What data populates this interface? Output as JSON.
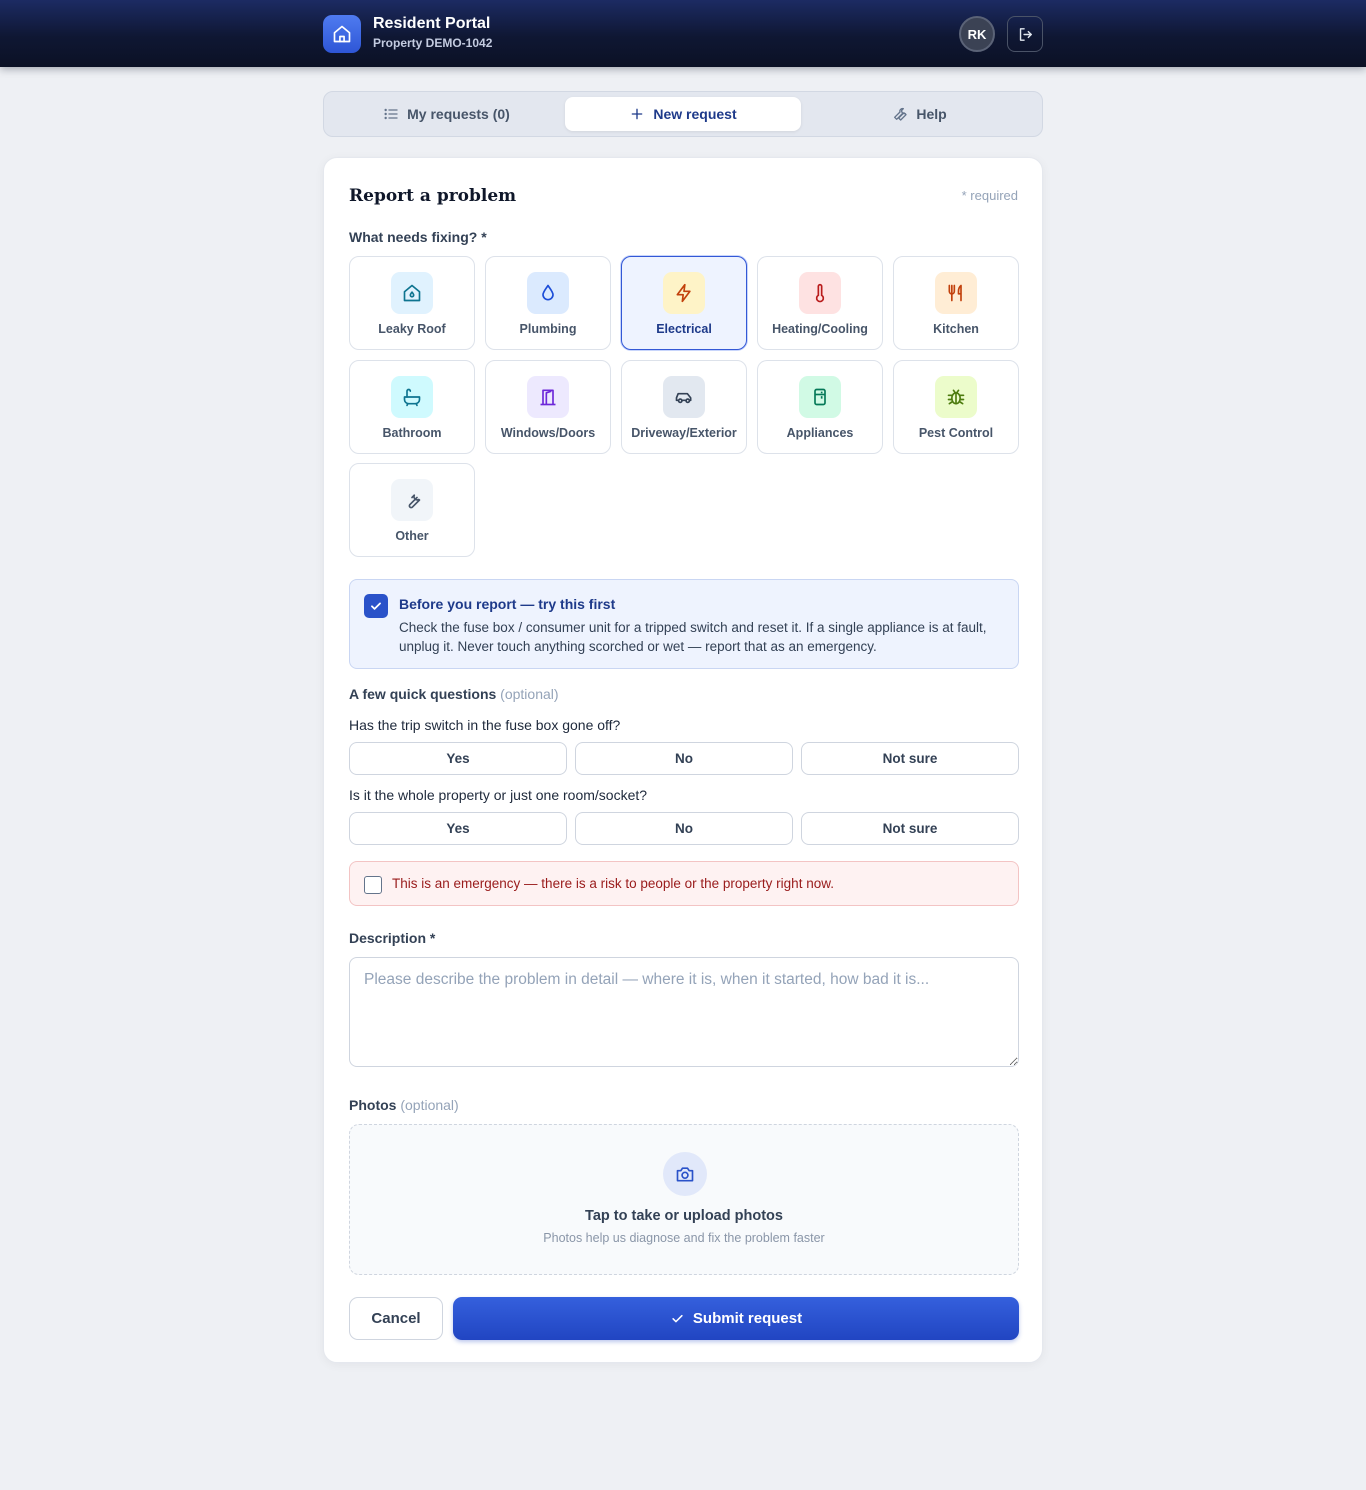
{
  "header": {
    "title": "Resident Portal",
    "subtitle": "Property DEMO-1042",
    "avatar_initials": "RK"
  },
  "tabs": [
    {
      "label": "My requests (0)",
      "icon": "list-icon",
      "active": false
    },
    {
      "label": "New request",
      "icon": "plus-icon",
      "active": true
    },
    {
      "label": "Help",
      "icon": "wrench-icon",
      "active": false
    }
  ],
  "form": {
    "title": "Report a problem",
    "required_note": "* required",
    "category_label": "What needs fixing? *",
    "categories": [
      {
        "label": "Leaky Roof",
        "icon": "house-icon",
        "color": "#0e7490",
        "bg": "#e0f2fe",
        "selected": false
      },
      {
        "label": "Plumbing",
        "icon": "droplet-icon",
        "color": "#1d4ed8",
        "bg": "#dbeafe",
        "selected": false
      },
      {
        "label": "Electrical",
        "icon": "lightning-icon",
        "color": "#c2410c",
        "bg": "#fef3c7",
        "selected": true
      },
      {
        "label": "Heating/Cooling",
        "icon": "thermometer-icon",
        "color": "#b91c1c",
        "bg": "#fee2e2",
        "selected": false
      },
      {
        "label": "Kitchen",
        "icon": "utensils-icon",
        "color": "#c2410c",
        "bg": "#ffedd5",
        "selected": false
      },
      {
        "label": "Bathroom",
        "icon": "bath-icon",
        "color": "#0e7490",
        "bg": "#cffafe",
        "selected": false
      },
      {
        "label": "Windows/Doors",
        "icon": "door-icon",
        "color": "#6d28d9",
        "bg": "#ede9fe",
        "selected": false
      },
      {
        "label": "Driveway/Exterior",
        "icon": "car-icon",
        "color": "#334155",
        "bg": "#e2e8f0",
        "selected": false
      },
      {
        "label": "Appliances",
        "icon": "fridge-icon",
        "color": "#047857",
        "bg": "#d1fae5",
        "selected": false
      },
      {
        "label": "Pest Control",
        "icon": "bug-icon",
        "color": "#4d7c0f",
        "bg": "#ecfccb",
        "selected": false
      },
      {
        "label": "Other",
        "icon": "wrench-icon",
        "color": "#475569",
        "bg": "#f1f5f9",
        "selected": false
      }
    ],
    "tip": {
      "title": "Before you report — try this first",
      "body": "Check the fuse box / consumer unit for a tripped switch and reset it. If a single appliance is at fault, unplug it. Never touch anything scorched or wet — report that as an emergency.",
      "checked": true
    },
    "questions_label": "A few quick questions",
    "questions_optional": "(optional)",
    "questions": [
      {
        "text": "Has the trip switch in the fuse box gone off?",
        "options": [
          "Yes",
          "No",
          "Not sure"
        ]
      },
      {
        "text": "Is it the whole property or just one room/socket?",
        "options": [
          "Yes",
          "No",
          "Not sure"
        ]
      }
    ],
    "emergency_label": "This is an emergency — there is a risk to people or the property right now.",
    "description_label": "Description *",
    "description_placeholder": "Please describe the problem in detail — where it is, when it started, how bad it is...",
    "description_value": "",
    "photos_label": "Photos",
    "photos_optional": "(optional)",
    "photos_title": "Tap to take or upload photos",
    "photos_sub": "Photos help us diagnose and fix the problem faster",
    "cancel_label": "Cancel",
    "submit_label": "Submit request"
  }
}
